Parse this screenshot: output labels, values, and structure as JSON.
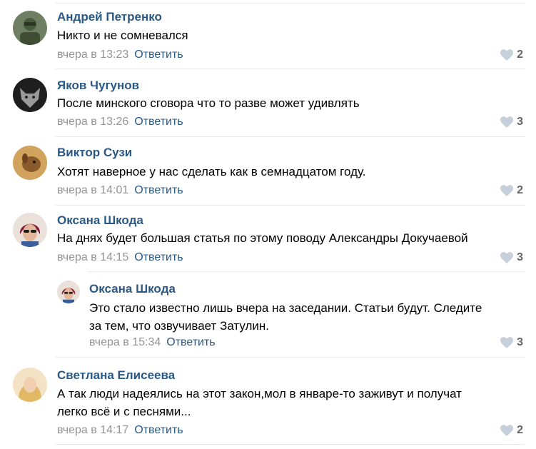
{
  "reply_label": "Ответить",
  "comments": [
    {
      "author": "Андрей Петренко",
      "text": "Никто и не сомневался",
      "time": "вчера в 13:23",
      "likes": "2",
      "avatar_icon": "soldier-avatar-icon"
    },
    {
      "author": "Яков Чугунов",
      "text": "После минского сговора что то разве может удивлять",
      "time": "вчера в 13:26",
      "likes": "3",
      "avatar_icon": "wolf-avatar-icon"
    },
    {
      "author": "Виктор Сузи",
      "text": "Хотят наверное у нас сделать как в семнадцатом году.",
      "time": "вчера в 14:01",
      "likes": "2",
      "avatar_icon": "dog-avatar-icon"
    },
    {
      "author": "Оксана Шкода",
      "text": "На днях будет большая статья по этому поводу Александры Докучаевой",
      "time": "вчера в 14:15",
      "likes": "3",
      "avatar_icon": "woman-sunglasses-avatar-icon"
    },
    {
      "author": "Оксана Шкода",
      "text": "Это стало известно лишь вчера на заседании. Статьи будут. Следите\nза тем, что озвучивает Затулин.",
      "time": "вчера в 15:34",
      "likes": "3",
      "avatar_icon": "woman-sunglasses-avatar-icon"
    },
    {
      "author": "Светлана Елисеева",
      "text": "А так люди надеялись на этот закон,мол в январе-то заживут и получат\nлегко всё и с песнями...",
      "time": "вчера в 14:17",
      "likes": "2",
      "avatar_icon": "blonde-woman-avatar-icon"
    }
  ],
  "colors": {
    "link": "#2a5885",
    "meta": "#939393",
    "separator": "#e7e8ec",
    "like_count": "#656565"
  }
}
